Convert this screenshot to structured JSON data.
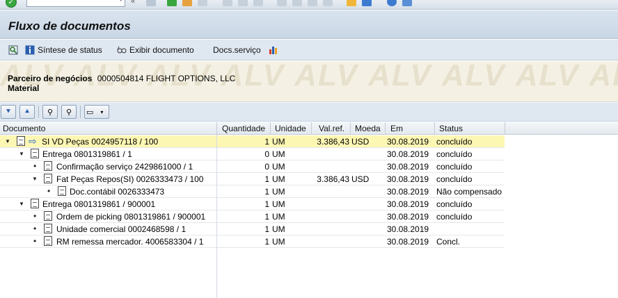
{
  "title": "Fluxo de documentos",
  "toolbar": {
    "sintese_label": "Síntese de status",
    "exibir_label": "Exibir documento",
    "docs_label": "Docs.serviço"
  },
  "header": {
    "partner_label": "Parceiro de negócios",
    "partner_value": "0000504814 FLIGHT OPTIONS, LLC",
    "material_label": "Material",
    "watermark": "ALV"
  },
  "columns": {
    "documento": "Documento",
    "quantidade": "Quantidade",
    "unidade": "Unidade",
    "valref": "Val.ref.",
    "moeda": "Moeda",
    "em": "Em",
    "status": "Status"
  },
  "rows": [
    {
      "doc": "SI VD Peças 0024957118 / 100",
      "qty": "1",
      "unit": "UM",
      "val": "3.386,43",
      "cur": "USD",
      "date": "30.08.2019",
      "status": "concluído"
    },
    {
      "doc": "Entrega 0801319861 / 1",
      "qty": "0",
      "unit": "UM",
      "val": "",
      "cur": "",
      "date": "30.08.2019",
      "status": "concluído"
    },
    {
      "doc": "Confirmação serviço 2429861000 / 1",
      "qty": "0",
      "unit": "UM",
      "val": "",
      "cur": "",
      "date": "30.08.2019",
      "status": "concluído"
    },
    {
      "doc": "Fat Peças Repos(SI) 0026333473 / 100",
      "qty": "1",
      "unit": "UM",
      "val": "3.386,43",
      "cur": "USD",
      "date": "30.08.2019",
      "status": "concluído"
    },
    {
      "doc": "Doc.contábil 0026333473",
      "qty": "1",
      "unit": "UM",
      "val": "",
      "cur": "",
      "date": "30.08.2019",
      "status": "Não compensado"
    },
    {
      "doc": "Entrega 0801319861 / 900001",
      "qty": "1",
      "unit": "UM",
      "val": "",
      "cur": "",
      "date": "30.08.2019",
      "status": "concluído"
    },
    {
      "doc": "Ordem de picking 0801319861 / 900001",
      "qty": "1",
      "unit": "UM",
      "val": "",
      "cur": "",
      "date": "30.08.2019",
      "status": "concluído"
    },
    {
      "doc": "Unidade comercial 0002468598 / 1",
      "qty": "1",
      "unit": "UM",
      "val": "",
      "cur": "",
      "date": "30.08.2019",
      "status": ""
    },
    {
      "doc": "RM remessa mercador. 4006583304 / 1",
      "qty": "1",
      "unit": "UM",
      "val": "",
      "cur": "",
      "date": "30.08.2019",
      "status": "Concl."
    }
  ]
}
